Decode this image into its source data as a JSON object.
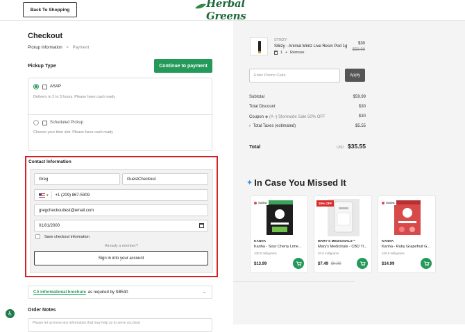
{
  "header": {
    "back_label": "Back To Shopping",
    "logo_text": "Herbal Greens"
  },
  "checkout": {
    "title": "Checkout",
    "breadcrumb": {
      "step1": "Pickup Information",
      "sep": ">",
      "step2": "Payment"
    },
    "pickup_heading": "Pickup Type",
    "continue_label": "Continue to payment",
    "options": [
      {
        "label": "ASAP",
        "desc": "Delivery in 2 to 3 hours. Please have cash ready",
        "selected": true
      },
      {
        "label": "Scheduled Pickup",
        "desc": "Choose your time slot. Please have cash ready",
        "selected": false
      }
    ]
  },
  "contact": {
    "heading": "Contact Information",
    "first_name": "Greg",
    "last_name": "GuestCheckout",
    "phone": "+1 (209) 867-5309",
    "email": "gregcheckouttest@email.com",
    "dob": "01/01/2000",
    "save_label": "Save checkout information",
    "member_text": "Already a member?",
    "signin_label": "Sign in into your account"
  },
  "brochure": {
    "link_text": "CA informational brochure",
    "suffix": "as required by SB540"
  },
  "notes": {
    "heading": "Order Notes",
    "placeholder": "Please let us know any information that may help us to serve you best"
  },
  "cart": {
    "item": {
      "brand": "STIIIZY",
      "name": "Stiiizy - Animal Mintz Live Resin Pod 1g",
      "qty": "1",
      "remove": "Remove",
      "price": "$30",
      "old_price": "$59.99"
    },
    "promo_placeholder": "Enter Promo Code",
    "apply_label": "Apply",
    "summary": [
      {
        "label": "Subtotal",
        "value": "$59.99"
      },
      {
        "label": "Total Discount",
        "value": "$30"
      },
      {
        "label": "Coupon",
        "tag": "(A -) Storewide Sale 50% OFF",
        "value": "$30"
      },
      {
        "label": "Total Taxes (estimated)",
        "value": "$5.55"
      }
    ],
    "total_label": "Total",
    "total_currency": "USD",
    "total_value": "$35.55"
  },
  "missed": {
    "heading": "In Case You Missed It",
    "products": [
      {
        "tag": "Sativa",
        "brand": "KANHA",
        "name": "Kanha - Sour Cherry Lime...",
        "mg": "100.0 milligrams",
        "price": "$13.99",
        "old_price": ""
      },
      {
        "tag": "25% OFF",
        "brand": "MARY'S MEDICINALS™",
        "name": "Mary's Medicinals - CBD Tr...",
        "mg": "20.0 milligrams",
        "price": "$7.49",
        "old_price": "$9.99"
      },
      {
        "tag": "Sativa",
        "brand": "KANHA",
        "name": "Kanha - Ruby Grapefruit G...",
        "mg": "100.0 milligrams",
        "price": "$14.99",
        "old_price": ""
      }
    ]
  },
  "colors": {
    "accent": "#239a5a",
    "highlight": "#d42222"
  }
}
